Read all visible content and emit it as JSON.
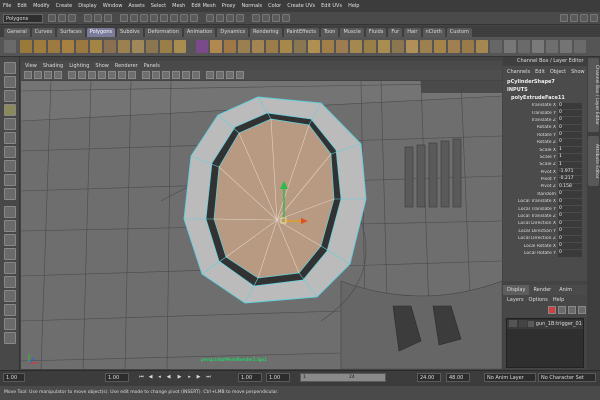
{
  "menu": [
    "File",
    "Edit",
    "Modify",
    "Create",
    "Display",
    "Window",
    "Assets",
    "Select",
    "Mesh",
    "Edit Mesh",
    "Proxy",
    "Normals",
    "Color",
    "Create UVs",
    "Edit UVs",
    "Help"
  ],
  "mode_select": "Polygons",
  "shelf_tabs": [
    "General",
    "Curves",
    "Surfaces",
    "Polygons",
    "Subdivs",
    "Deformation",
    "Animation",
    "Dynamics",
    "Rendering",
    "PaintEffects",
    "Toon",
    "Muscle",
    "Fluids",
    "Fur",
    "Hair",
    "nCloth",
    "Custom"
  ],
  "active_shelf_tab": "Polygons",
  "panel_menu": [
    "View",
    "Shading",
    "Lighting",
    "Show",
    "Renderer",
    "Panels"
  ],
  "viewport": {
    "object_label": "persp.lidarMeshRender1.lgo1"
  },
  "channel_box": {
    "header": "Channel Box / Layer Editor",
    "menu": [
      "Channels",
      "Edit",
      "Object",
      "Show"
    ],
    "object_name": "pCylinderShape7",
    "inputs_label": "INPUTS",
    "node_name": "polyExtrudeFace11",
    "attributes": [
      {
        "name": "Translate X",
        "value": "0"
      },
      {
        "name": "Translate Y",
        "value": "0"
      },
      {
        "name": "Translate Z",
        "value": "0"
      },
      {
        "name": "Rotate X",
        "value": "0"
      },
      {
        "name": "Rotate Y",
        "value": "0"
      },
      {
        "name": "Rotate Z",
        "value": "0"
      },
      {
        "name": "Scale X",
        "value": "1"
      },
      {
        "name": "Scale Y",
        "value": "1"
      },
      {
        "name": "Scale Z",
        "value": "1"
      },
      {
        "name": "Pivot X",
        "value": "-1.971"
      },
      {
        "name": "Pivot Y",
        "value": "-0.217"
      },
      {
        "name": "Pivot Z",
        "value": "0.158"
      },
      {
        "name": "Random",
        "value": "0"
      },
      {
        "name": "Local Translate X",
        "value": "0"
      },
      {
        "name": "Local Translate Y",
        "value": "0"
      },
      {
        "name": "Local Translate Z",
        "value": "0"
      },
      {
        "name": "Local Direction X",
        "value": "0"
      },
      {
        "name": "Local Direction Y",
        "value": "0"
      },
      {
        "name": "Local Direction Z",
        "value": "0"
      },
      {
        "name": "Local Rotate X",
        "value": "0"
      },
      {
        "name": "Local Rotate Y",
        "value": "0"
      }
    ]
  },
  "side_tabs": [
    "Channel Box / Layer Editor",
    "Attribute Editor"
  ],
  "layer_editor": {
    "tabs": [
      "Display",
      "Render",
      "Anim"
    ],
    "active_tab": "Display",
    "menu": [
      "Layers",
      "Options",
      "Help"
    ],
    "layer_name": "gun_1B:trigger_01"
  },
  "timeline": {
    "start_field": "1.00",
    "current_field": "1.00",
    "range_start": "1.00",
    "range_start2": "1.00",
    "range_marker": "1",
    "range_end_marker": "24",
    "end_field": "24.00",
    "end_field2": "48.00",
    "anim_layer": "No Anim Layer",
    "character_set": "No Character Set"
  },
  "help_line": "Move Tool: Use manipulator to move object(s). Use edit mode to change pivot (INSERT). Ctrl+LMB to move perpendicular."
}
